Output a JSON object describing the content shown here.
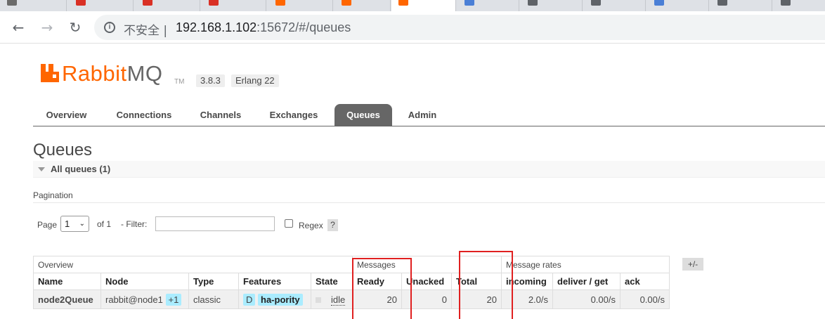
{
  "browser": {
    "tab_favicons": [
      "#6b6b6b",
      "#d93025",
      "#d93025",
      "#d93025",
      "#ff6600",
      "#ff6600",
      "#ff6600",
      "#4a7fd6",
      "#5f6368",
      "#5f6368",
      "#4a7fd6",
      "#5f6368",
      "#5f6368"
    ],
    "security_label": "不安全",
    "url_host": "192.168.1.102",
    "url_rest": ":15672/#/queues"
  },
  "app": {
    "logo_word1": "Rabbit",
    "logo_word2": "MQ",
    "logo_tm": "TM",
    "version": "3.8.3",
    "erlang": "Erlang 22",
    "accent": "#ff6600"
  },
  "nav": {
    "tabs": [
      {
        "label": "Overview"
      },
      {
        "label": "Connections"
      },
      {
        "label": "Channels"
      },
      {
        "label": "Exchanges"
      },
      {
        "label": "Queues"
      },
      {
        "label": "Admin"
      }
    ],
    "active": "Queues"
  },
  "page": {
    "title": "Queues",
    "section_label": "All queues (1)"
  },
  "pagination": {
    "title": "Pagination",
    "page_label": "Page",
    "page_value": "1",
    "of_label": "of 1",
    "filter_label": "- Filter:",
    "filter_value": "",
    "regex_label": "Regex",
    "help_label": "?"
  },
  "table": {
    "groups": [
      "Overview",
      "Messages",
      "Message rates"
    ],
    "columns": [
      "Name",
      "Node",
      "Type",
      "Features",
      "State",
      "Ready",
      "Unacked",
      "Total",
      "incoming",
      "deliver / get",
      "ack"
    ],
    "rows": [
      {
        "name": "node2Queue",
        "node": "rabbit@node1",
        "node_badge": "+1",
        "type": "classic",
        "feature_flag": "D",
        "feature_policy": "ha-pority",
        "state": "idle",
        "ready": "20",
        "unacked": "0",
        "total": "20",
        "incoming": "2.0/s",
        "deliver_get": "0.00/s",
        "ack": "0.00/s"
      }
    ],
    "toggle_label": "+/-"
  },
  "annotation_color": "#e02020"
}
